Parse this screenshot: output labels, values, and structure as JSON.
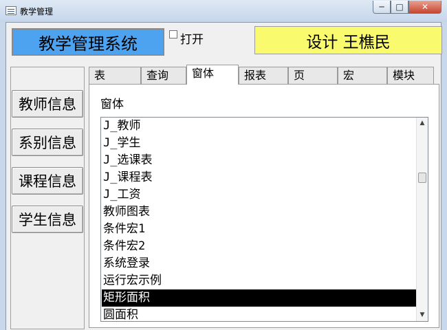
{
  "window": {
    "title": "教学管理",
    "minimize": "─",
    "maximize": "□",
    "close": "✕",
    "icon": "form-icon"
  },
  "header": {
    "system_title": "教学管理系统",
    "open_checkbox": {
      "label": "打开",
      "checked": false
    },
    "designer": "设计  王樵民"
  },
  "side_buttons": [
    "教师信息",
    "系别信息",
    "课程信息",
    "学生信息"
  ],
  "tabs": {
    "items": [
      "表",
      "查询",
      "窗体",
      "报表",
      "页",
      "宏",
      "模块"
    ],
    "active": "窗体"
  },
  "panel": {
    "label": "窗体",
    "list": {
      "items": [
        "J_教师",
        "J_学生",
        "J_选课表",
        "J_课程表",
        "J_工资",
        "教师图表",
        "条件宏1",
        "条件宏2",
        "系统登录",
        "运行宏示例",
        "矩形面积",
        "圆面积"
      ],
      "selected": "矩形面积"
    },
    "scroll_up": "▲",
    "scroll_down": "▼"
  }
}
